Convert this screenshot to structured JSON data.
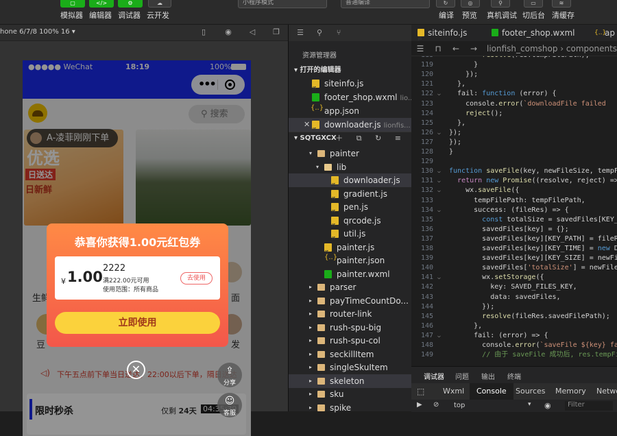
{
  "toolbar": {
    "buttons": [
      {
        "label": "模拟器"
      },
      {
        "label": "编辑器"
      },
      {
        "label": "调试器"
      },
      {
        "label": "云开发"
      }
    ],
    "mode_select": "小程序模式",
    "compile_select": "普通编译",
    "right": [
      {
        "label": "编译"
      },
      {
        "label": "预览"
      },
      {
        "label": "真机调试"
      },
      {
        "label": "切后台"
      },
      {
        "label": "清缓存"
      }
    ]
  },
  "simulator": {
    "device": "hone 6/7/8 100% 16 ▾",
    "status": {
      "carrier": "●●●●● WeChat",
      "time": "18:19",
      "battery": "100%"
    },
    "search_placeholder": "搜索",
    "banner_toast": "A-凌菲刚刚下单啦",
    "banner_title": "优选",
    "banner_tag": "日送达",
    "banner_sub": "日新鲜",
    "categories": [
      "生鲜",
      "面",
      "豆",
      "发"
    ],
    "notice": "下午五点前下单当日送达，22:00以后下单，隔日送达",
    "flash": {
      "title": "限时秒杀",
      "left_label": "仅剩",
      "days": "24天",
      "clock": "04:35:39"
    },
    "popup": {
      "title": "恭喜你获得1.00元红包券",
      "currency": "¥",
      "amount": "1.00",
      "coupon_name": "2222",
      "condition": "满222.00元可用",
      "scope": "使用范围：所有商品",
      "use_label": "去使用",
      "cta": "立即使用"
    },
    "fab_share": "分享",
    "fab_service": "客服"
  },
  "explorer": {
    "title": "资源管理器",
    "open_editors_label": "打开的编辑器",
    "open_editors": [
      {
        "name": "siteinfo.js",
        "hint": ""
      },
      {
        "name": "footer_shop.wxml",
        "hint": "lio..."
      },
      {
        "name": "app.json",
        "hint": ""
      },
      {
        "name": "downloader.js",
        "hint": "lionfis..."
      }
    ],
    "project_label": "SQTGXCX",
    "tree": [
      {
        "name": "painter"
      },
      {
        "name": "lib"
      },
      {
        "name": "downloader.js"
      },
      {
        "name": "gradient.js"
      },
      {
        "name": "pen.js"
      },
      {
        "name": "qrcode.js"
      },
      {
        "name": "util.js"
      },
      {
        "name": "painter.js"
      },
      {
        "name": "painter.json"
      },
      {
        "name": "painter.wxml"
      },
      {
        "name": "parser"
      },
      {
        "name": "payTimeCountDo..."
      },
      {
        "name": "router-link"
      },
      {
        "name": "rush-spu-big"
      },
      {
        "name": "rush-spu-col"
      },
      {
        "name": "seckillItem"
      },
      {
        "name": "singleSkuItem"
      },
      {
        "name": "skeleton"
      },
      {
        "name": "sku"
      },
      {
        "name": "spike"
      }
    ]
  },
  "editor": {
    "tabs": [
      {
        "name": "siteinfo.js"
      },
      {
        "name": "footer_shop.wxml"
      },
      {
        "name": "ap"
      }
    ],
    "breadcrumb": "lionfish_comshop › components",
    "lines": [
      {
        "n": "118",
        "code": "        resolve(res.tempFilePath);"
      },
      {
        "n": "119",
        "code": "      }"
      },
      {
        "n": "120",
        "code": "    });"
      },
      {
        "n": "121",
        "code": "  },"
      },
      {
        "n": "122",
        "code": "  fail: function (error) {"
      },
      {
        "n": "123",
        "code": "    console.error(`downloadFile failed"
      },
      {
        "n": "124",
        "code": "    reject();"
      },
      {
        "n": "125",
        "code": "  },"
      },
      {
        "n": "126",
        "code": "});"
      },
      {
        "n": "127",
        "code": "});"
      },
      {
        "n": "128",
        "code": "}"
      },
      {
        "n": "129",
        "code": ""
      },
      {
        "n": "130",
        "code": "function saveFile(key, newFileSize, tempFi"
      },
      {
        "n": "131",
        "code": "  return new Promise((resolve, reject) =>"
      },
      {
        "n": "132",
        "code": "    wx.saveFile({"
      },
      {
        "n": "133",
        "code": "      tempFilePath: tempFilePath,"
      },
      {
        "n": "134",
        "code": "      success: (fileRes) => {"
      },
      {
        "n": "135",
        "code": "        const totalSize = savedFiles[KEY_T"
      },
      {
        "n": "136",
        "code": "        savedFiles[key] = {};"
      },
      {
        "n": "137",
        "code": "        savedFiles[key][KEY_PATH] = fileRe"
      },
      {
        "n": "138",
        "code": "        savedFiles[key][KEY_TIME] = new Da"
      },
      {
        "n": "139",
        "code": "        savedFiles[key][KEY_SIZE] = newFil"
      },
      {
        "n": "140",
        "code": "        savedFiles['totalSize'] = newFileS"
      },
      {
        "n": "141",
        "code": "        wx.setStorage({"
      },
      {
        "n": "142",
        "code": "          key: SAVED_FILES_KEY,"
      },
      {
        "n": "143",
        "code": "          data: savedFiles,"
      },
      {
        "n": "144",
        "code": "        });"
      },
      {
        "n": "145",
        "code": "        resolve(fileRes.savedFilePath);"
      },
      {
        "n": "146",
        "code": "      },"
      },
      {
        "n": "147",
        "code": "      fail: (error) => {"
      },
      {
        "n": "148",
        "code": "        console.error(`saveFile ${key} fai"
      },
      {
        "n": "149",
        "code": "        // 由于 saveFile 成功后, res.tempFi"
      }
    ],
    "devtools_tabs": [
      {
        "name": "调试器"
      },
      {
        "name": "问题"
      },
      {
        "name": "输出"
      },
      {
        "name": "终端"
      }
    ],
    "sub_tabs": [
      {
        "name": "Wxml"
      },
      {
        "name": "Console"
      },
      {
        "name": "Sources"
      },
      {
        "name": "Memory"
      },
      {
        "name": "Netwo"
      }
    ],
    "context": "top",
    "filter_placeholder": "Filter"
  }
}
